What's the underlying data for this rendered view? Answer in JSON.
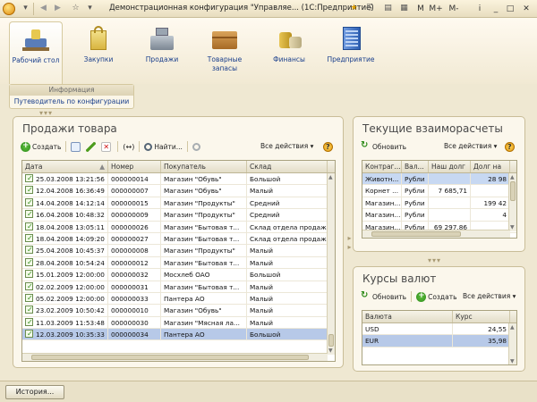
{
  "window": {
    "title": "Демонстрационная конфигурация \"Управляе... (1С:Предприятие)",
    "buttons": [
      "M",
      "M+",
      "M-",
      "i",
      "_",
      "□",
      "✕"
    ]
  },
  "sections": [
    {
      "label": "Рабочий стол",
      "icon": "desktop-icon"
    },
    {
      "label": "Закупки",
      "icon": "shopping-bag-icon"
    },
    {
      "label": "Продажи",
      "icon": "cash-register-icon"
    },
    {
      "label": "Товарные запасы",
      "icon": "box-icon"
    },
    {
      "label": "Финансы",
      "icon": "coins-icon"
    },
    {
      "label": "Предприятие",
      "icon": "building-icon"
    }
  ],
  "nav": {
    "header": "Информация",
    "item": "Путеводитель по конфигурации"
  },
  "sales": {
    "title": "Продажи товара",
    "toolbar": {
      "create": "Создать",
      "find": "Найти...",
      "all_actions": "Все действия"
    },
    "columns": [
      "Дата",
      "Номер",
      "Покупатель",
      "Склад"
    ],
    "rows": [
      {
        "date": "25.03.2008 13:21:56",
        "number": "000000014",
        "buyer": "Магазин \"Обувь\"",
        "warehouse": "Большой"
      },
      {
        "date": "12.04.2008 16:36:49",
        "number": "000000007",
        "buyer": "Магазин \"Обувь\"",
        "warehouse": "Малый"
      },
      {
        "date": "14.04.2008 14:12:14",
        "number": "000000015",
        "buyer": "Магазин \"Продукты\"",
        "warehouse": "Средний"
      },
      {
        "date": "16.04.2008 10:48:32",
        "number": "000000009",
        "buyer": "Магазин \"Продукты\"",
        "warehouse": "Средний"
      },
      {
        "date": "18.04.2008 13:05:11",
        "number": "000000026",
        "buyer": "Магазин \"Бытовая т...",
        "warehouse": "Склад отдела продаж"
      },
      {
        "date": "18.04.2008 14:09:20",
        "number": "000000027",
        "buyer": "Магазин \"Бытовая т...",
        "warehouse": "Склад отдела продаж"
      },
      {
        "date": "25.04.2008 10:45:37",
        "number": "000000008",
        "buyer": "Магазин \"Продукты\"",
        "warehouse": "Малый"
      },
      {
        "date": "28.04.2008 10:54:24",
        "number": "000000012",
        "buyer": "Магазин \"Бытовая т...",
        "warehouse": "Малый"
      },
      {
        "date": "15.01.2009 12:00:00",
        "number": "000000032",
        "buyer": "Мосхлеб ОАО",
        "warehouse": "Большой"
      },
      {
        "date": "02.02.2009 12:00:00",
        "number": "000000031",
        "buyer": "Магазин \"Бытовая т...",
        "warehouse": "Малый"
      },
      {
        "date": "05.02.2009 12:00:00",
        "number": "000000033",
        "buyer": "Пантера АО",
        "warehouse": "Малый"
      },
      {
        "date": "23.02.2009 10:50:42",
        "number": "000000010",
        "buyer": "Магазин \"Обувь\"",
        "warehouse": "Малый"
      },
      {
        "date": "11.03.2009 11:53:48",
        "number": "000000030",
        "buyer": "Магазин \"Мясная ла...",
        "warehouse": "Малый"
      },
      {
        "date": "12.03.2009 10:35:33",
        "number": "000000034",
        "buyer": "Пантера АО",
        "warehouse": "Большой"
      }
    ]
  },
  "settlements": {
    "title": "Текущие взаиморасчеты",
    "toolbar": {
      "refresh": "Обновить",
      "all_actions": "Все действия"
    },
    "columns": [
      "Контраг...",
      "Вал...",
      "Наш долг",
      "Долг на"
    ],
    "rows": [
      {
        "counterparty": "Животн...",
        "currency": "Рубли",
        "our_debt": "",
        "their_debt": "28 98"
      },
      {
        "counterparty": "Корнет ...",
        "currency": "Рубли",
        "our_debt": "7 685,71",
        "their_debt": ""
      },
      {
        "counterparty": "Магазин...",
        "currency": "Рубли",
        "our_debt": "",
        "their_debt": "199 42"
      },
      {
        "counterparty": "Магазин...",
        "currency": "Рубли",
        "our_debt": "",
        "their_debt": "4"
      },
      {
        "counterparty": "Магазин...",
        "currency": "Рубли",
        "our_debt": "69 297,86",
        "their_debt": ""
      }
    ]
  },
  "rates": {
    "title": "Курсы валют",
    "toolbar": {
      "refresh": "Обновить",
      "create": "Создать",
      "all_actions": "Все действия"
    },
    "columns": [
      "Валюта",
      "Курс"
    ],
    "rows": [
      {
        "currency": "USD",
        "rate": "24,55"
      },
      {
        "currency": "EUR",
        "rate": "35,98"
      }
    ]
  },
  "footer": {
    "history": "История..."
  }
}
